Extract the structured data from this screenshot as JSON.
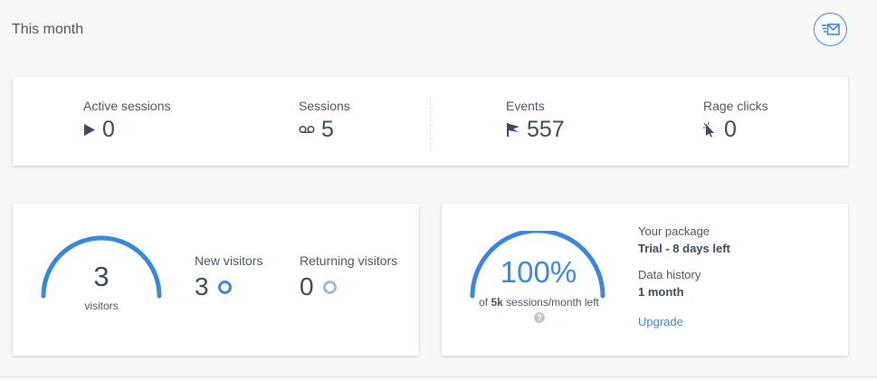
{
  "header": {
    "title": "This month",
    "mail_icon": "mail-icon"
  },
  "colors": {
    "accent": "#3b87d8",
    "returning": "#9fbad6",
    "text": "#3c4a5c"
  },
  "stats": [
    {
      "label": "Active sessions",
      "value": "0",
      "icon": "play-icon"
    },
    {
      "label": "Sessions",
      "value": "5",
      "icon": "recording-icon"
    },
    {
      "label": "Events",
      "value": "557",
      "icon": "flag-icon"
    },
    {
      "label": "Rage clicks",
      "value": "0",
      "icon": "rage-cursor-icon"
    }
  ],
  "visitors": {
    "total": "3",
    "caption": "visitors",
    "new_label": "New visitors",
    "new_value": "3",
    "returning_label": "Returning visitors",
    "returning_value": "0"
  },
  "package": {
    "percent": "100%",
    "percent_fraction": 1.0,
    "caption_prefix": "of ",
    "caption_bold": "5k",
    "caption_suffix": " sessions/month left",
    "help": "?",
    "package_label": "Your package",
    "package_value": "Trial - 8 days left",
    "history_label": "Data history",
    "history_value": "1 month",
    "upgrade_label": "Upgrade"
  }
}
